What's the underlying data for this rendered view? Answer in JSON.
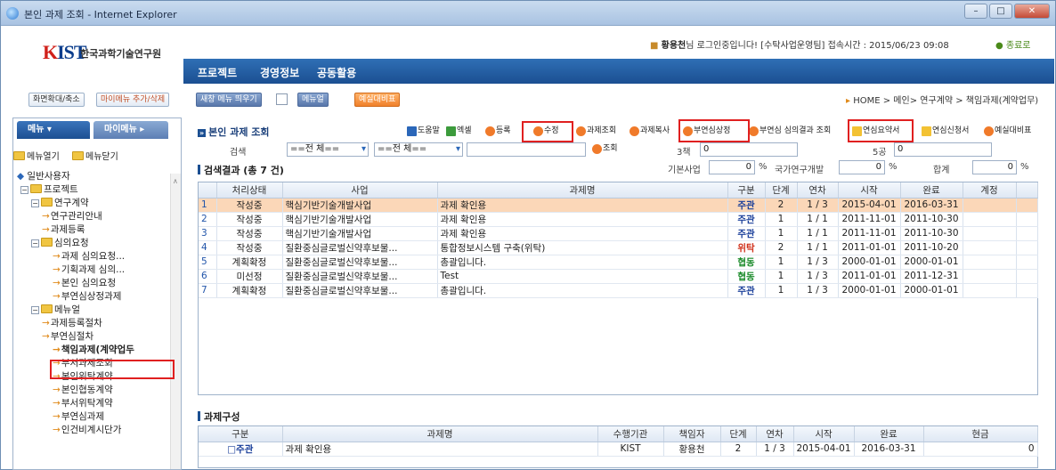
{
  "window": {
    "title": "본인 과제 조회 - Internet Explorer"
  },
  "header": {
    "logo_text": "KIST",
    "org_name": "한국과학기술연구원",
    "user_name": "황용천",
    "user_info_rest": "님 로그인중입니다! [수탁사업운영팀] 접속시간 : 2015/06/23 09:08",
    "logout": "종료로"
  },
  "nav": {
    "items": [
      "프로젝트",
      "경영정보",
      "공동활용"
    ]
  },
  "toolbar2": {
    "zoom_btn": "화면확대/축소",
    "mymenu_btn": "마이메뉴 추가/삭제",
    "newwin_btn": "새창 메뉴 띄우기",
    "manual_btn": "메뉴얼",
    "budget_btn": "예실대비표",
    "breadcrumb": "HOME > 메인> 연구계약 > 책임과제(계약업무)"
  },
  "sidebar": {
    "tab_menu": "메뉴",
    "tab_mymenu": "마이메뉴",
    "open_all": "메뉴열기",
    "close_all": "메뉴닫기",
    "tree": [
      {
        "label": "일반사용자"
      },
      {
        "label": "프로젝트"
      },
      {
        "label": "연구계약"
      },
      {
        "label": "연구관리안내"
      },
      {
        "label": "과제등록"
      },
      {
        "label": "심의요청"
      },
      {
        "label": "과제 심의요청..."
      },
      {
        "label": "기획과제 심의..."
      },
      {
        "label": "본인 심의요청"
      },
      {
        "label": "부연심상정과제"
      },
      {
        "label": "메뉴얼"
      },
      {
        "label": "과제등록절차"
      },
      {
        "label": "부연심절차"
      },
      {
        "label": "책임과제(계약업두"
      },
      {
        "label": "부서과제조회"
      },
      {
        "label": "본인위탁계약"
      },
      {
        "label": "본인협동계약"
      },
      {
        "label": "부서위탁계약"
      },
      {
        "label": "부연심과제"
      },
      {
        "label": "인건비계시단가"
      }
    ]
  },
  "main": {
    "title": "본인 과제 조회",
    "buttons": [
      "도움말",
      "엑셀",
      "등록",
      "수정",
      "과제조회",
      "과제복사",
      "부연심상정",
      "부연심 심의결과 조회",
      "연심요약서",
      "연심신청서",
      "예실대비표"
    ],
    "search": {
      "label": "검색",
      "sel1": "==전 체==",
      "sel2": "==전 체==",
      "query_btn": "조회",
      "label_3": "3책",
      "val_3": "0",
      "label_5": "5공",
      "val_5": "0",
      "label_basic": "기본사업",
      "val_basic": "0",
      "label_nation": "국가연구개발",
      "val_nation": "0",
      "label_total": "합계",
      "val_total": "0",
      "pct": "%"
    },
    "result_title": "검색결과 (총 7 건)",
    "columns": [
      "처리상태",
      "사업",
      "과제명",
      "구분",
      "단계",
      "연차",
      "시작",
      "완료",
      "계정"
    ],
    "rows": [
      {
        "n": "1",
        "status": "작성중",
        "biz": "핵심기반기술개발사업",
        "name": "과제 확인용",
        "kind": "주관",
        "step": "2",
        "year": "1 / 3",
        "start": "2015-04-01",
        "end": "2016-03-31",
        "acct": ""
      },
      {
        "n": "2",
        "status": "작성중",
        "biz": "핵심기반기술개발사업",
        "name": "과제 확인용",
        "kind": "주관",
        "step": "1",
        "year": "1 / 1",
        "start": "2011-11-01",
        "end": "2011-10-30",
        "acct": ""
      },
      {
        "n": "3",
        "status": "작성중",
        "biz": "핵심기반기술개발사업",
        "name": "과제 확인용",
        "kind": "주관",
        "step": "1",
        "year": "1 / 1",
        "start": "2011-11-01",
        "end": "2011-10-30",
        "acct": ""
      },
      {
        "n": "4",
        "status": "작성중",
        "biz": "질환중심글로벌신약후보물...",
        "name": "통합정보시스템 구축(위탁)",
        "kind": "위탁",
        "step": "2",
        "year": "1 / 1",
        "start": "2011-01-01",
        "end": "2011-10-20",
        "acct": ""
      },
      {
        "n": "5",
        "status": "계획확정",
        "biz": "질환중심글로벌신약후보물...",
        "name": "총괄입니다.",
        "kind": "협동",
        "step": "1",
        "year": "1 / 3",
        "start": "2000-01-01",
        "end": "2000-01-01",
        "acct": ""
      },
      {
        "n": "6",
        "status": "미선정",
        "biz": "질환중심글로벌신약후보물...",
        "name": "Test",
        "kind": "협동",
        "step": "1",
        "year": "1 / 3",
        "start": "2011-01-01",
        "end": "2011-12-31",
        "acct": ""
      },
      {
        "n": "7",
        "status": "계획확정",
        "biz": "질환중심글로벌신약후보물...",
        "name": "총괄입니다.",
        "kind": "주관",
        "step": "1",
        "year": "1 / 3",
        "start": "2000-01-01",
        "end": "2000-01-01",
        "acct": ""
      }
    ],
    "composition_title": "과제구성",
    "comp_columns": [
      "구분",
      "과제명",
      "수행기관",
      "책임자",
      "단계",
      "연차",
      "시작",
      "완료",
      "현금"
    ],
    "comp_rows": [
      {
        "kind": "주관",
        "name": "과제 확인용",
        "org": "KIST",
        "lead": "황용천",
        "step": "2",
        "year": "1 / 3",
        "start": "2015-04-01",
        "end": "2016-03-31",
        "cash": "0"
      }
    ]
  },
  "colors": {
    "nav": "#1b4f92",
    "selected_row": "#fbd7b8",
    "highlight": "#e02020"
  }
}
